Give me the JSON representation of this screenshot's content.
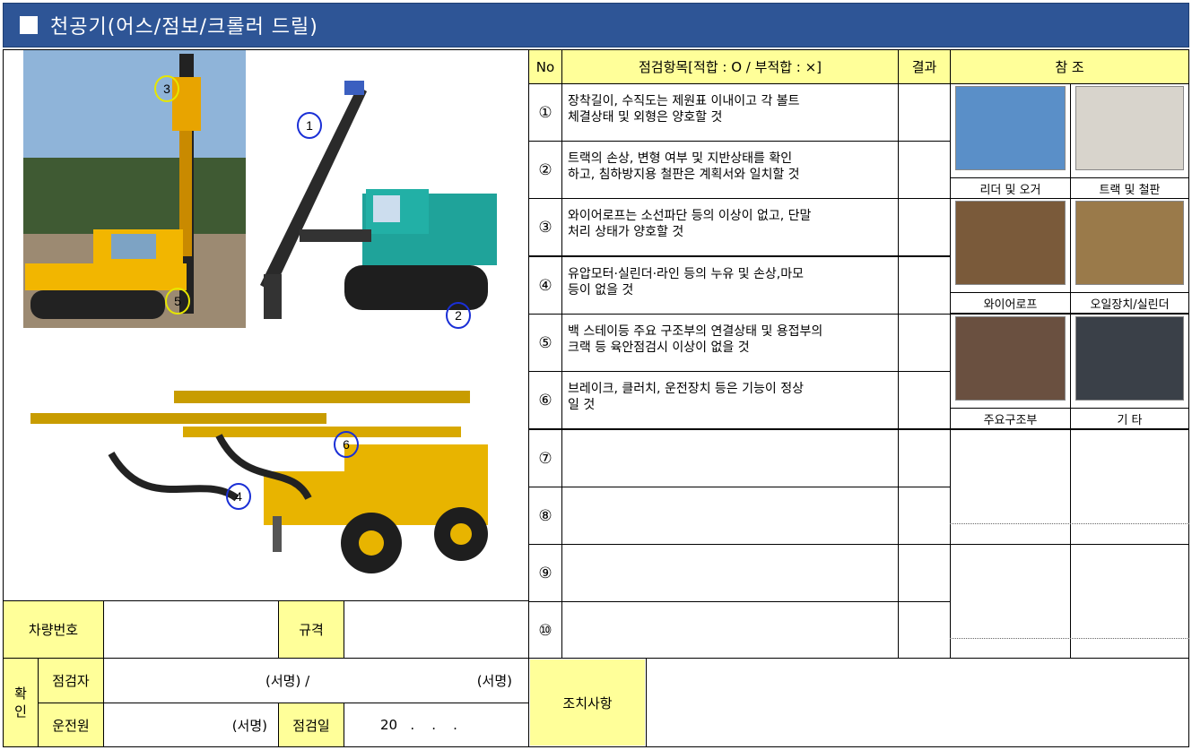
{
  "title": "천공기(어스/점보/크롤러 드릴)",
  "table": {
    "col_no": "No",
    "col_item": "점검항목[적합 : O / 부적합 : ×]",
    "col_result": "결과",
    "col_ref": "참 조",
    "rows": [
      {
        "no": "①",
        "text": "장착길이, 수직도는 제원표 이내이고 각 볼트\n체결상태 및 외형은 양호할 것"
      },
      {
        "no": "②",
        "text": "트랙의 손상, 변형 여부 및 지반상태를 확인\n하고, 침하방지용 철판은 계획서와 일치할 것"
      },
      {
        "no": "③",
        "text": "와이어로프는 소선파단 등의 이상이 없고, 단말\n처리 상태가 양호할 것"
      },
      {
        "no": "④",
        "text": "유압모터·실린더·라인 등의 누유 및 손상,마모\n등이 없을 것"
      },
      {
        "no": "⑤",
        "text": "백 스테이등 주요 구조부의 연결상태 및 용접부의\n크랙 등 육안점검시 이상이 없을 것"
      },
      {
        "no": "⑥",
        "text": "브레이크, 클러치, 운전장치 등은 기능이 정상\n일 것"
      },
      {
        "no": "⑦",
        "text": ""
      },
      {
        "no": "⑧",
        "text": ""
      },
      {
        "no": "⑨",
        "text": ""
      },
      {
        "no": "⑩",
        "text": ""
      }
    ],
    "ref_labels": [
      "리더 및 오거",
      "트랙 및 철판",
      "와이어로프",
      "오일장치/실린더",
      "주요구조부",
      "기 타"
    ]
  },
  "photo_markers": [
    "1",
    "2",
    "3",
    "4",
    "5",
    "6"
  ],
  "footer": {
    "vehicle_no_label": "차량번호",
    "spec_label": "규격",
    "confirm_label": "확\n인",
    "inspector_label": "점검자",
    "inspector_sign": "(서명) /",
    "inspector_sign2": "(서명)",
    "operator_label": "운전원",
    "operator_sign": "(서명)",
    "date_label": "점검일",
    "date_value": "20   .    .    .",
    "action_label": "조치사항"
  },
  "colors": {
    "title_bg": "#2e5596",
    "header_yellow": "#ffff99",
    "machine_yellow": "#e8b400",
    "machine_teal": "#1fa39a"
  }
}
